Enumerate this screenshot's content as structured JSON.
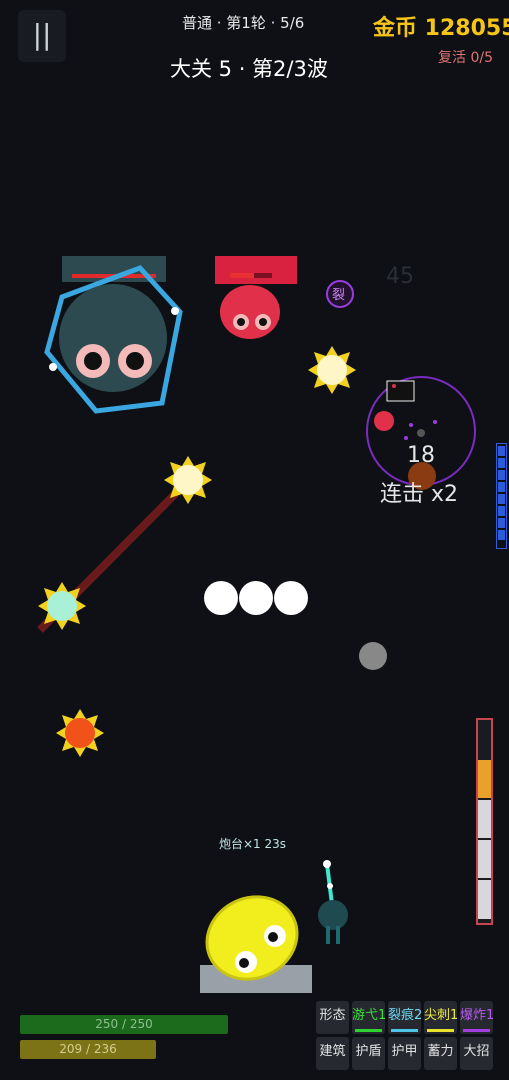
{
  "hud": {
    "pause_icon": "||",
    "round_info": "普通 · 第1轮 · 5/6",
    "coins": "金币 128055",
    "revive": "复活 0/5",
    "stage_title": "大关 5 · 第2/3波"
  },
  "combat": {
    "ghost_number": "45",
    "split_badge": "裂",
    "combo_count": "18",
    "combo_text": "连击 x2",
    "turret_label": "炮台×1 23s"
  },
  "player": {
    "hp_text": "250 / 250",
    "hp_fraction": 1.0,
    "xp_text": "209 / 236",
    "xp_fraction": 0.886
  },
  "skills": {
    "row1": [
      {
        "label": "形态",
        "color": "#262930",
        "accent": ""
      },
      {
        "label": "游弋1",
        "color": "#262930",
        "accent": "#2fd12f",
        "text_color": "#39e039"
      },
      {
        "label": "裂痕2",
        "color": "#262930",
        "accent": "#4fc6e8",
        "text_color": "#6ed8f2"
      },
      {
        "label": "尖刺1",
        "color": "#262930",
        "accent": "#e8e32a",
        "text_color": "#f0ea3a"
      },
      {
        "label": "爆炸1",
        "color": "#262930",
        "accent": "#a63de0",
        "text_color": "#b85af0"
      }
    ],
    "row2": [
      {
        "label": "建筑"
      },
      {
        "label": "护盾"
      },
      {
        "label": "护甲"
      },
      {
        "label": "蓄力"
      },
      {
        "label": "大招"
      }
    ]
  },
  "colors": {
    "coin": "#f5c518",
    "enemy_red": "#e0304a",
    "enemy_dark": "#2c4a4f",
    "shield_blue": "#3aa7e0",
    "player_yellow": "#f2ee1e",
    "hp_green": "#1c6a1c",
    "xp_olive": "#7c7216"
  }
}
